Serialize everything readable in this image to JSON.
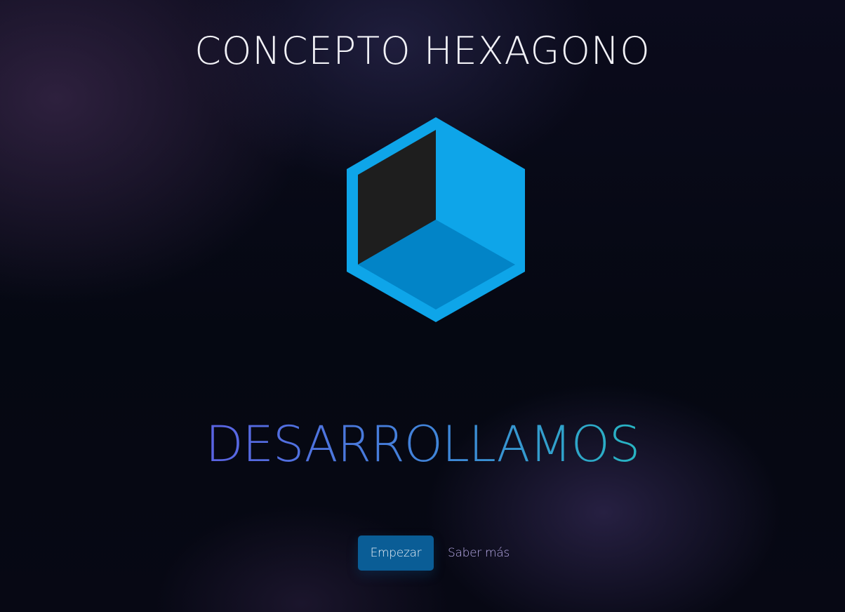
{
  "hero": {
    "title": "CONCEPTO HEXAGONO",
    "headline": "DESARROLLAMOS",
    "logo_icon": "hexagon-cube-icon",
    "colors": {
      "logo_primary": "#0ea5e9",
      "logo_floor": "#0284c7",
      "logo_wall": "#1e1e1e",
      "headline_gradient_start": "#5b63e3",
      "headline_gradient_end": "#27b5c2",
      "button_primary": "#0a5d96",
      "link": "#b8abe8"
    }
  },
  "actions": {
    "primary_label": "Empezar",
    "secondary_label": "Saber más"
  }
}
